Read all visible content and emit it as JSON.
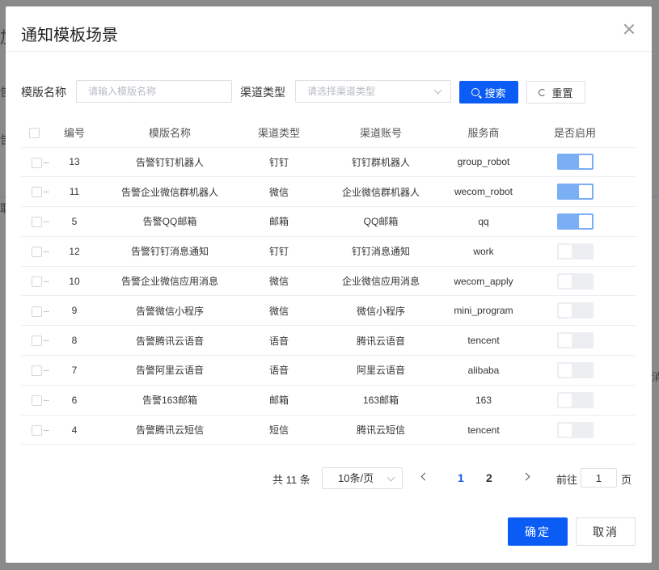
{
  "dialog": {
    "title": "通知模板场景"
  },
  "filters": {
    "template_name_label": "模版名称",
    "template_name_placeholder": "请输入模版名称",
    "channel_type_label": "渠道类型",
    "channel_type_placeholder": "请选择渠道类型",
    "search_label": "搜索",
    "reset_label": "重置"
  },
  "table": {
    "headers": {
      "id": "编号",
      "name": "模版名称",
      "channel_type": "渠道类型",
      "channel_account": "渠道账号",
      "provider": "服务商",
      "enabled": "是否启用"
    },
    "rows": [
      {
        "id": "13",
        "name": "告警钉钉机器人",
        "channel_type": "钉钉",
        "channel_account": "钉钉群机器人",
        "provider": "group_robot",
        "enabled": true
      },
      {
        "id": "11",
        "name": "告警企业微信群机器人",
        "channel_type": "微信",
        "channel_account": "企业微信群机器人",
        "provider": "wecom_robot",
        "enabled": true
      },
      {
        "id": "5",
        "name": "告警QQ邮箱",
        "channel_type": "邮箱",
        "channel_account": "QQ邮箱",
        "provider": "qq",
        "enabled": true
      },
      {
        "id": "12",
        "name": "告警钉钉消息通知",
        "channel_type": "钉钉",
        "channel_account": "钉钉消息通知",
        "provider": "work",
        "enabled": false
      },
      {
        "id": "10",
        "name": "告警企业微信应用消息",
        "channel_type": "微信",
        "channel_account": "企业微信应用消息",
        "provider": "wecom_apply",
        "enabled": false
      },
      {
        "id": "9",
        "name": "告警微信小程序",
        "channel_type": "微信",
        "channel_account": "微信小程序",
        "provider": "mini_program",
        "enabled": false
      },
      {
        "id": "8",
        "name": "告警腾讯云语音",
        "channel_type": "语音",
        "channel_account": "腾讯云语音",
        "provider": "tencent",
        "enabled": false
      },
      {
        "id": "7",
        "name": "告警阿里云语音",
        "channel_type": "语音",
        "channel_account": "阿里云语音",
        "provider": "alibaba",
        "enabled": false
      },
      {
        "id": "6",
        "name": "告警163邮箱",
        "channel_type": "邮箱",
        "channel_account": "163邮箱",
        "provider": "163",
        "enabled": false
      },
      {
        "id": "4",
        "name": "告警腾讯云短信",
        "channel_type": "短信",
        "channel_account": "腾讯云短信",
        "provider": "tencent",
        "enabled": false
      }
    ]
  },
  "pagination": {
    "total_label": "共 11 条",
    "page_size": "10条/页",
    "pages": [
      "1",
      "2"
    ],
    "current_page": "1",
    "goto_label": "前往",
    "goto_value": "1",
    "page_unit": "页"
  },
  "footer": {
    "confirm_label": "确定",
    "cancel_label": "取消"
  },
  "background": {
    "frag_1": "加",
    "frag_2": "告",
    "frag_3": "告",
    "frag_4": "取",
    "frag_5": "消"
  },
  "colors": {
    "primary": "#0b5cf5",
    "switch_on": "#7aaef5",
    "switch_off": "#eceef2"
  }
}
